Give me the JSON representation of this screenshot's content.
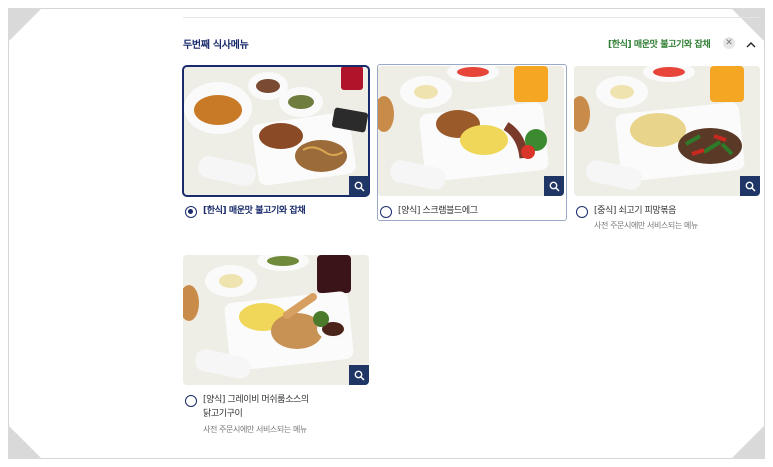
{
  "section": {
    "title": "두번째 식사메뉴",
    "selected_summary": "[한식] 매운맛 불고기와 잡채",
    "clear_icon": "close-icon",
    "collapse_icon": "chevron-up-icon"
  },
  "menu_items": [
    {
      "label": "[한식] 매운맛 불고기와 잡채",
      "note": "",
      "selected": true,
      "image": "bulgogi-japchae-meal-photo"
    },
    {
      "label": "[양식] 스크램블드에그",
      "note": "",
      "selected": false,
      "image": "scrambled-egg-meal-photo"
    },
    {
      "label": "[중식] 쇠고기 피망볶음",
      "note": "사전 주문시에만 서비스되는 메뉴",
      "selected": false,
      "image": "beef-pepper-stirfry-meal-photo"
    },
    {
      "label_line1": "[양식] 그레이비 머쉬룸소스의",
      "label_line2": "닭고기구이",
      "note": "사전 주문시에만 서비스되는 메뉴",
      "selected": false,
      "image": "roast-chicken-mushroom-gravy-meal-photo"
    }
  ],
  "colors": {
    "navy": "#1a2b6b",
    "zoom_button": "#1e3566",
    "summary_green": "#2e7d32"
  },
  "zoom_icon": "magnifier-icon"
}
